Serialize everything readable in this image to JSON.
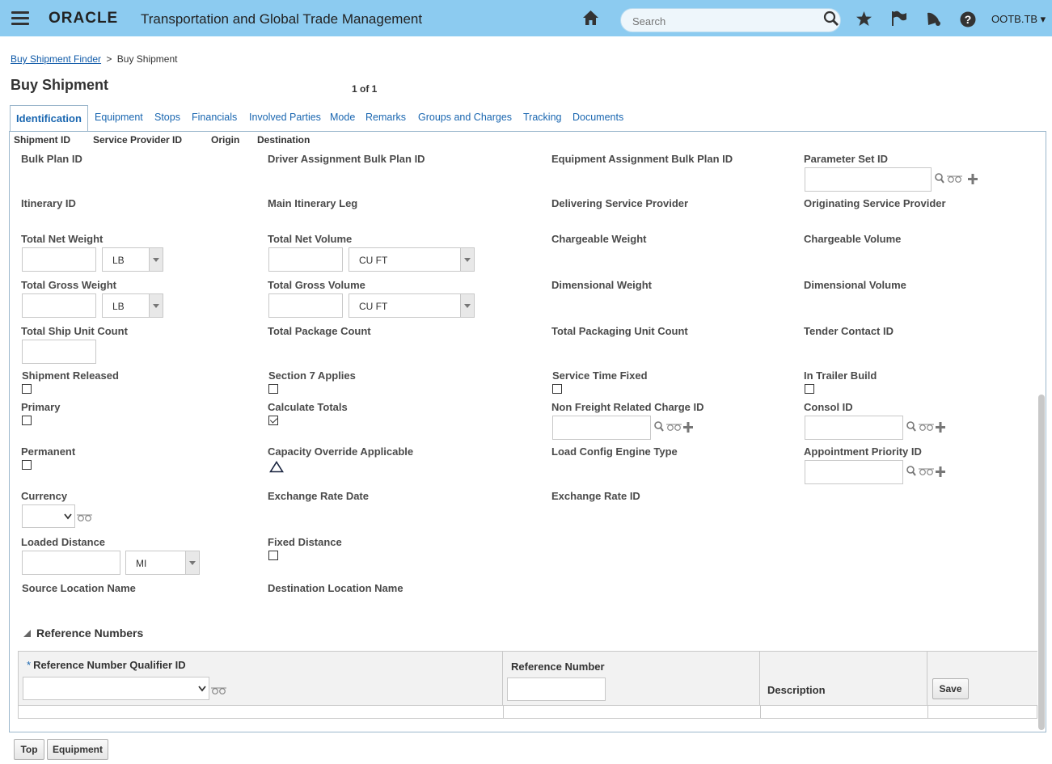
{
  "header": {
    "brand": "ORACLE",
    "app_title": "Transportation and Global Trade Management",
    "search_placeholder": "Search",
    "user": "OOTB.TB ▾"
  },
  "breadcrumb": {
    "link": "Buy Shipment Finder",
    "separator": ">",
    "current": "Buy Shipment"
  },
  "page": {
    "title": "Buy Shipment",
    "pager": "1 of 1"
  },
  "tabs": [
    "Identification",
    "Equipment",
    "Stops",
    "Financials",
    "Involved Parties",
    "Mode",
    "Remarks",
    "Groups and Charges",
    "Tracking",
    "Documents"
  ],
  "summary": [
    "Shipment ID",
    "Service Provider ID",
    "Origin",
    "Destination"
  ],
  "fields": {
    "bulk_plan_id": "Bulk Plan ID",
    "driver_assignment_bulk_plan_id": "Driver Assignment Bulk Plan ID",
    "equipment_assignment_bulk_plan_id": "Equipment Assignment Bulk Plan ID",
    "parameter_set_id": "Parameter Set ID",
    "itinerary_id": "Itinerary ID",
    "main_itinerary_leg": "Main Itinerary Leg",
    "delivering_service_provider": "Delivering Service Provider",
    "originating_service_provider": "Originating Service Provider",
    "total_net_weight": "Total Net Weight",
    "total_net_volume": "Total Net Volume",
    "chargeable_weight": "Chargeable Weight",
    "chargeable_volume": "Chargeable Volume",
    "total_gross_weight": "Total Gross Weight",
    "total_gross_volume": "Total Gross Volume",
    "dimensional_weight": "Dimensional Weight",
    "dimensional_volume": "Dimensional Volume",
    "total_ship_unit_count": "Total Ship Unit Count",
    "total_package_count": "Total Package Count",
    "total_packaging_unit_count": "Total Packaging Unit Count",
    "tender_contact_id": "Tender Contact ID",
    "shipment_released": "Shipment Released",
    "section_7_applies": "Section 7 Applies",
    "service_time_fixed": "Service Time Fixed",
    "in_trailer_build": "In Trailer Build",
    "primary": "Primary",
    "calculate_totals": "Calculate Totals",
    "non_freight_related_charge_id": "Non Freight Related Charge ID",
    "consol_id": "Consol ID",
    "permanent": "Permanent",
    "capacity_override_applicable": "Capacity Override Applicable",
    "load_config_engine_type": "Load Config Engine Type",
    "appointment_priority_id": "Appointment Priority ID",
    "currency": "Currency",
    "exchange_rate_date": "Exchange Rate Date",
    "exchange_rate_id": "Exchange Rate ID",
    "loaded_distance": "Loaded Distance",
    "fixed_distance": "Fixed Distance",
    "source_location_name": "Source Location Name",
    "destination_location_name": "Destination Location Name"
  },
  "units": {
    "net_weight": "LB",
    "net_volume": "CU FT",
    "gross_weight": "LB",
    "gross_volume": "CU FT",
    "distance": "MI"
  },
  "checkboxes": {
    "shipment_released": false,
    "section_7_applies": false,
    "service_time_fixed": false,
    "in_trailer_build": false,
    "primary": false,
    "calculate_totals": true,
    "permanent": false,
    "fixed_distance": false
  },
  "reference_numbers": {
    "title": "Reference Numbers",
    "required_mark": "*",
    "col_qualifier": "Reference Number Qualifier ID",
    "col_number": "Reference Number",
    "col_description": "Description",
    "save_label": "Save"
  },
  "footer_buttons": {
    "top": "Top",
    "equipment": "Equipment"
  },
  "colors": {
    "header_bg": "#8ccbf0",
    "link": "#1966b0"
  }
}
